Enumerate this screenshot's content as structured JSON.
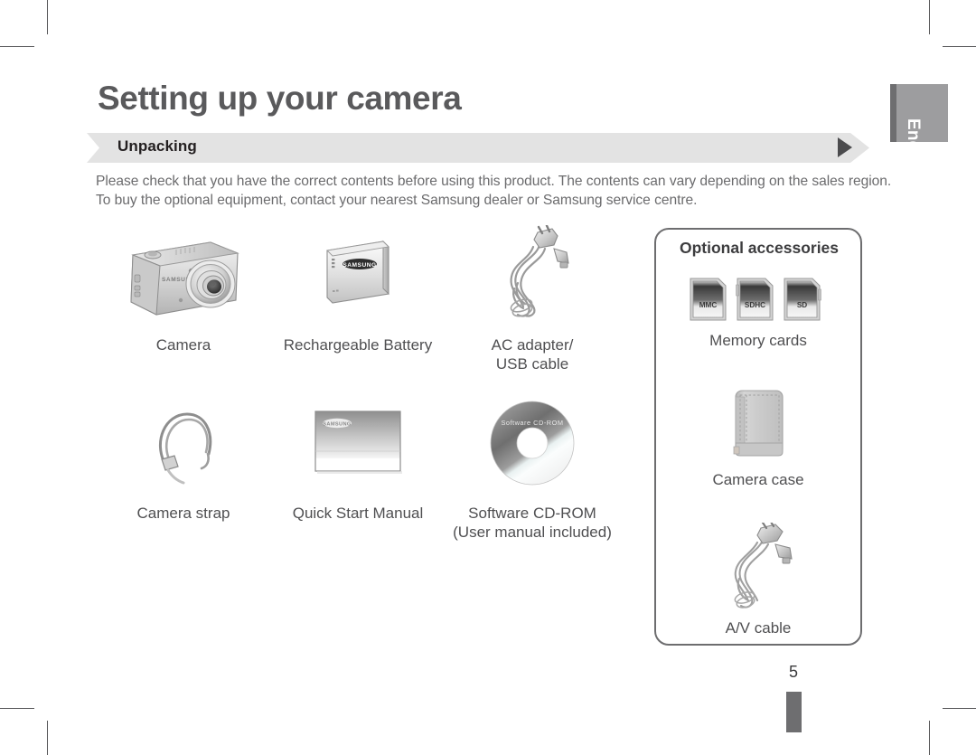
{
  "page": {
    "title": "Setting up your camera",
    "section_label": "Unpacking",
    "section_arrow_icon": "play-triangle-icon",
    "intro_line_1": "Please check that you have the correct contents before using this product. The contents can vary depending on the sales region.",
    "intro_line_2": "To buy the optional equipment, contact your nearest Samsung dealer or Samsung service centre.",
    "page_number": "5",
    "language_tab": "English"
  },
  "items": [
    {
      "id": "camera",
      "icon": "camera-icon",
      "caption": "Camera",
      "caption_sub": ""
    },
    {
      "id": "battery",
      "icon": "battery-icon",
      "caption": "Rechargeable Battery",
      "caption_sub": ""
    },
    {
      "id": "ac-usb",
      "icon": "cable-icon",
      "caption": "AC adapter/",
      "caption_sub": "USB cable"
    },
    {
      "id": "strap",
      "icon": "camera-strap-icon",
      "caption": "Camera strap",
      "caption_sub": ""
    },
    {
      "id": "quick-manual",
      "icon": "manual-book-icon",
      "caption": "Quick Start Manual",
      "caption_sub": ""
    },
    {
      "id": "cd-rom",
      "icon": "cd-disc-icon",
      "caption": "Software CD-ROM",
      "caption_sub": "(User manual included)"
    }
  ],
  "cd_label": "Software CD-ROM",
  "brand_label": "SAMSUNG",
  "optional": {
    "title": "Optional accessories",
    "items": [
      {
        "id": "memory-cards",
        "icon": "memory-card-icon",
        "caption": "Memory cards"
      },
      {
        "id": "camera-case",
        "icon": "camera-case-icon",
        "caption": "Camera case"
      },
      {
        "id": "av-cable",
        "icon": "av-cable-icon",
        "caption": "A/V cable"
      }
    ],
    "memory_card_labels": [
      "MMC",
      "SDHC",
      "SD"
    ]
  },
  "colors": {
    "title_gray": "#5a5a5c",
    "ribbon_gray": "#e3e3e3",
    "body_gray": "#6b6b6d",
    "tab_gray": "#9d9d9f",
    "tab_spine": "#6e6e70"
  }
}
